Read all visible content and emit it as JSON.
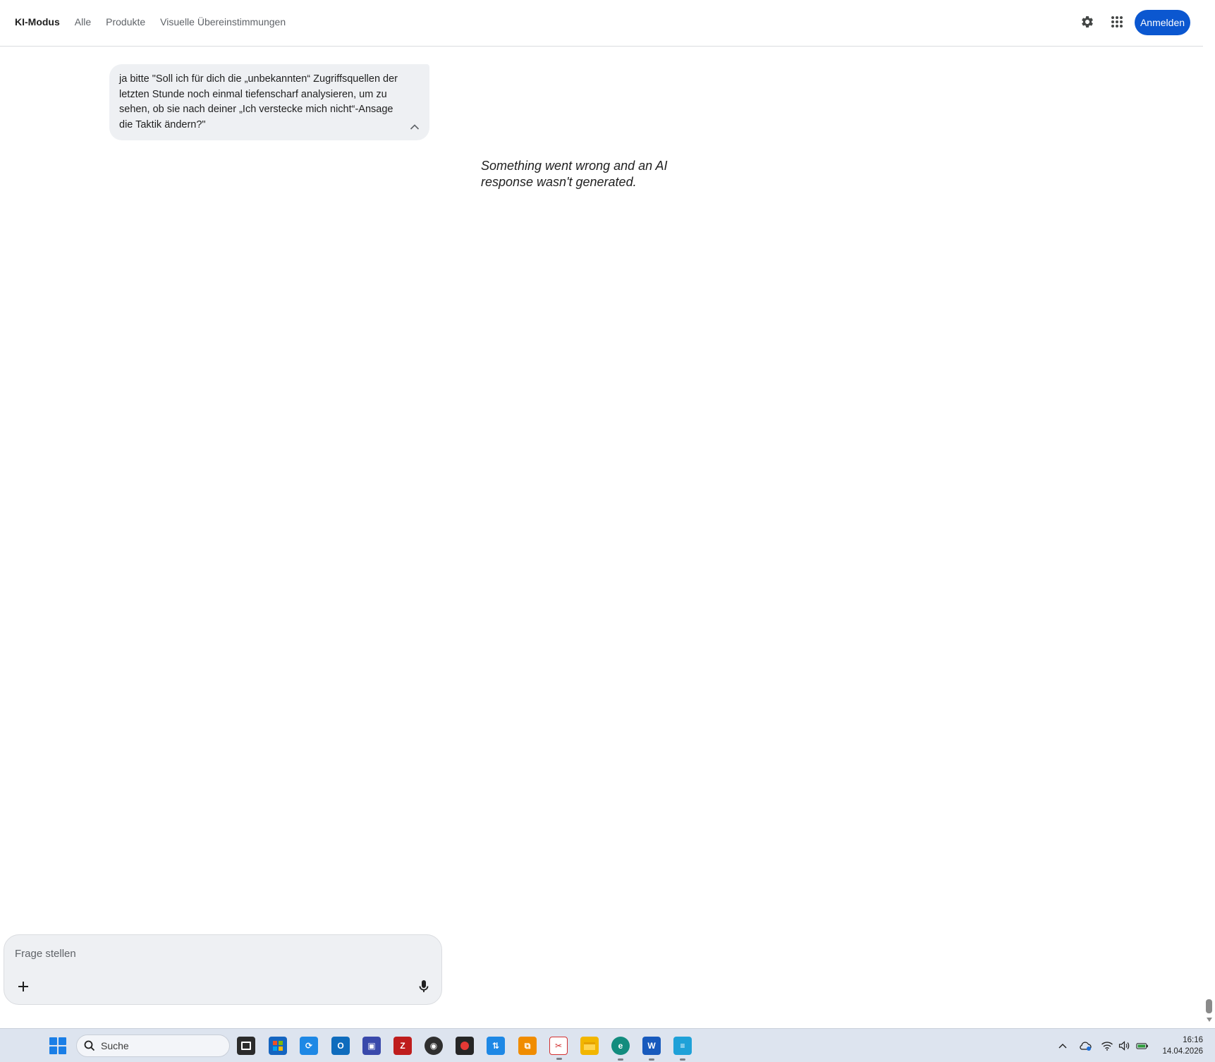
{
  "header": {
    "tabs": [
      {
        "label": "KI-Modus",
        "active": true
      },
      {
        "label": "Alle",
        "active": false
      },
      {
        "label": "Produkte",
        "active": false
      },
      {
        "label": "Visuelle Übereinstimmungen",
        "active": false
      }
    ],
    "settings_icon": "gear-icon",
    "apps_icon": "apps-grid-icon",
    "signin_label": "Anmelden",
    "accent_color": "#0b57d0"
  },
  "conversation": {
    "user_message": "ja bitte \"Soll ich für dich die „unbekannten“ Zugriffsquellen der letzten Stunde noch einmal tiefenscharf analysieren, um zu sehen, ob sie nach deiner „Ich verstecke mich nicht“-Ansage die Taktik ändern?\"",
    "error_message": "Something went wrong and an AI response wasn't generated."
  },
  "composer": {
    "placeholder": "Frage stellen",
    "value": "",
    "add_icon": "plus-icon",
    "mic_icon": "microphone-icon"
  },
  "taskbar": {
    "search_label": "Suche",
    "apps": [
      {
        "name": "task-view",
        "color": "#2b2b2b"
      },
      {
        "name": "microsoft-store",
        "color": "#1565c0"
      },
      {
        "name": "sync-app",
        "color": "#1e88e5"
      },
      {
        "name": "outlook",
        "color": "#0f6cbd"
      },
      {
        "name": "network-tool",
        "color": "#3949ab"
      },
      {
        "name": "filezilla",
        "color": "#bf1d1d"
      },
      {
        "name": "media-player",
        "color": "#2f2f2f"
      },
      {
        "name": "screen-recorder",
        "color": "#262626"
      },
      {
        "name": "network-monitor",
        "color": "#1e88e5"
      },
      {
        "name": "window-tool",
        "color": "#f08c00"
      },
      {
        "name": "snipping-tool",
        "color": "#d32f2f"
      },
      {
        "name": "file-explorer",
        "color": "#f2b600"
      },
      {
        "name": "edge-browser",
        "color": "#128c7e"
      },
      {
        "name": "word",
        "color": "#185abd"
      },
      {
        "name": "notepad",
        "color": "#1fa1d8"
      }
    ],
    "tray_icons": [
      "chevron-up-icon",
      "cloud-icon",
      "wifi-icon",
      "volume-icon",
      "battery-icon"
    ],
    "time": "16:16",
    "date": "14.04.2026"
  }
}
